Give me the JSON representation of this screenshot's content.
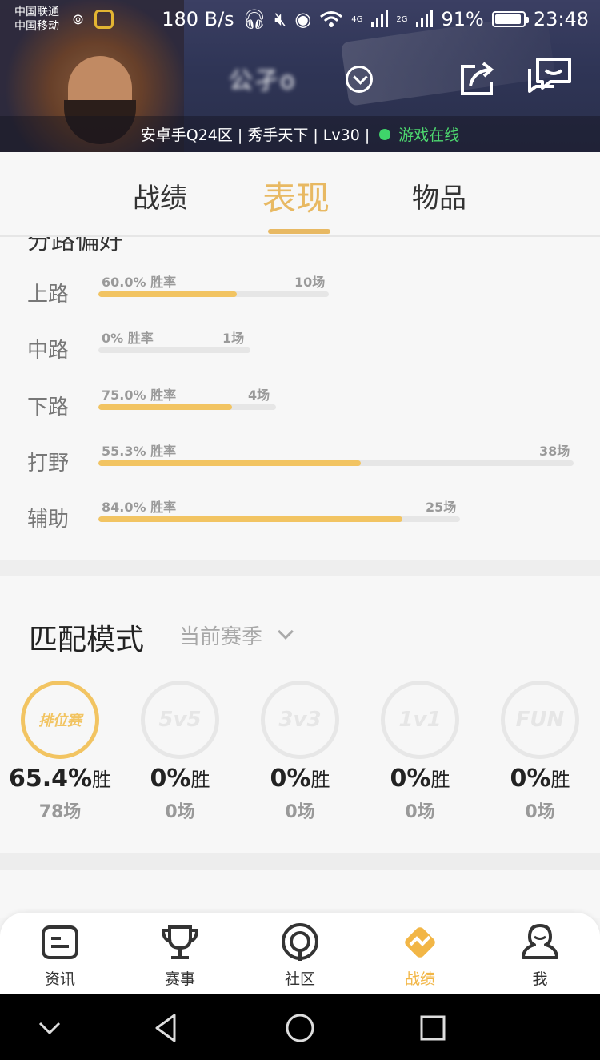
{
  "status_bar": {
    "carrier_1": "中国联通",
    "carrier_2": "中国移动",
    "speed": "180 B/s",
    "network_4g": "4G",
    "network_2g": "2G",
    "battery": "91%",
    "time": "23:48"
  },
  "header": {
    "player_name": "公孑o",
    "subtitle_server": "安卓手Q24区 | 秀手天下 | Lv30 |",
    "online_status": "游戏在线",
    "online_color": "#3fd46a"
  },
  "tabs": [
    {
      "label": "战绩"
    },
    {
      "label": "表现"
    },
    {
      "label": "物品"
    }
  ],
  "lanes_section": {
    "heading_cut": "分路偏好",
    "rate_suffix": "胜率",
    "lanes": [
      {
        "name": "上路",
        "win_rate": "60.0% 胜率",
        "games": "10场",
        "fill": 0.6
      },
      {
        "name": "中路",
        "win_rate": "0% 胜率",
        "games": "1场",
        "fill": 0.0
      },
      {
        "name": "下路",
        "win_rate": "75.0% 胜率",
        "games": "4场",
        "fill": 0.75
      },
      {
        "name": "打野",
        "win_rate": "55.3% 胜率",
        "games": "38场",
        "fill": 0.553
      },
      {
        "name": "辅助",
        "win_rate": "84.0% 胜率",
        "games": "25场",
        "fill": 0.84
      }
    ]
  },
  "match_mode": {
    "title": "匹配模式",
    "season": "当前赛季",
    "win_suffix": "胜",
    "modes": [
      {
        "icon_text": "排位赛",
        "pct": "65.4%",
        "games": "78场"
      },
      {
        "icon_text": "5v5",
        "pct": "0%",
        "games": "0场"
      },
      {
        "icon_text": "3v3",
        "pct": "0%",
        "games": "0场"
      },
      {
        "icon_text": "1v1",
        "pct": "0%",
        "games": "0场"
      },
      {
        "icon_text": "FUN",
        "pct": "0%",
        "games": "0场"
      }
    ]
  },
  "bottom_nav": [
    {
      "label": "资讯",
      "icon": "news-icon"
    },
    {
      "label": "赛事",
      "icon": "trophy-icon"
    },
    {
      "label": "社区",
      "icon": "community-icon"
    },
    {
      "label": "战绩",
      "icon": "stats-icon"
    },
    {
      "label": "我",
      "icon": "profile-icon"
    }
  ],
  "colors": {
    "accent": "#e8b963",
    "bar_fill": "#f2c462",
    "bar_track": "#e6e6e6",
    "online_green": "#3fd46a"
  }
}
